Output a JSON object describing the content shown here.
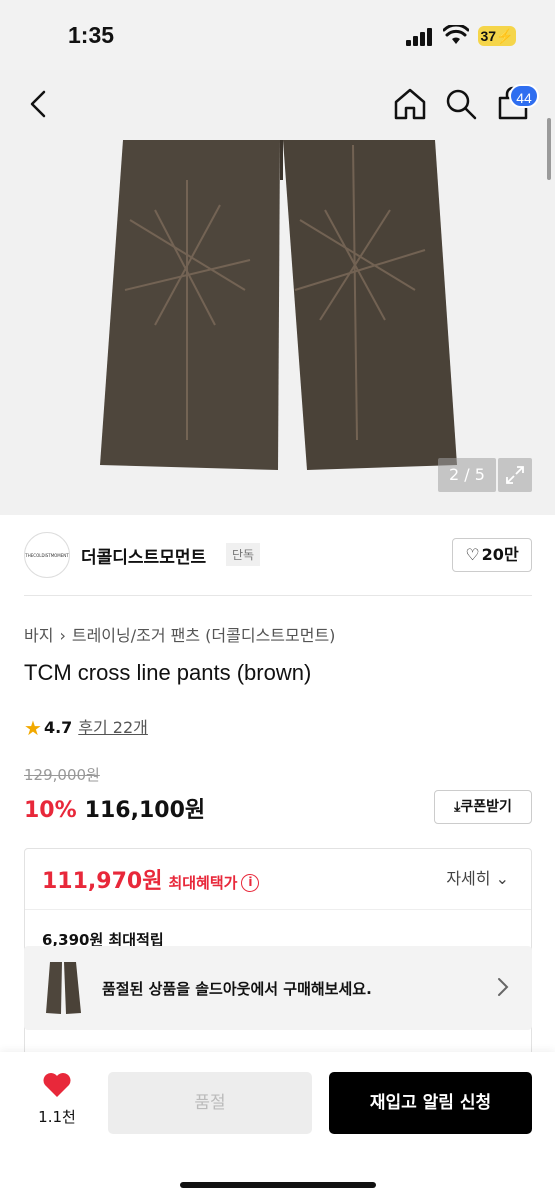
{
  "status_bar": {
    "time": "1:35",
    "battery": "37"
  },
  "header": {
    "cart_count": "44"
  },
  "gallery": {
    "counter": "2 / 5"
  },
  "brand": {
    "logo_text": "THECOLDISTMOMENT",
    "name": "더콜디스트모먼트",
    "tag": "단독",
    "likes": "20만"
  },
  "breadcrumb": [
    "바지",
    "트레이닝/조거 팬츠 (더콜디스트모먼트)"
  ],
  "product": {
    "title": "TCM cross line pants (brown)",
    "rating": "4.7",
    "reviews": "후기 22개",
    "original_price": "129,000원",
    "discount": "10%",
    "price": "116,100원",
    "coupon_label": "쿠폰받기"
  },
  "benefit": {
    "max_price": "111,970원",
    "max_label": "최대혜택가",
    "detail_label": "자세히",
    "points": "6,390원 최대적립"
  },
  "soldout_banner": {
    "text": "품절된 상품을 솔드아웃에서 구매해보세요."
  },
  "bottom": {
    "like_count": "1.1천",
    "soldout_label": "품절",
    "restock_label": "재입고 알림 신청"
  },
  "colors": {
    "accent_red": "#e8283a",
    "badge_blue": "#2f6ef0",
    "star": "#f2a900"
  }
}
